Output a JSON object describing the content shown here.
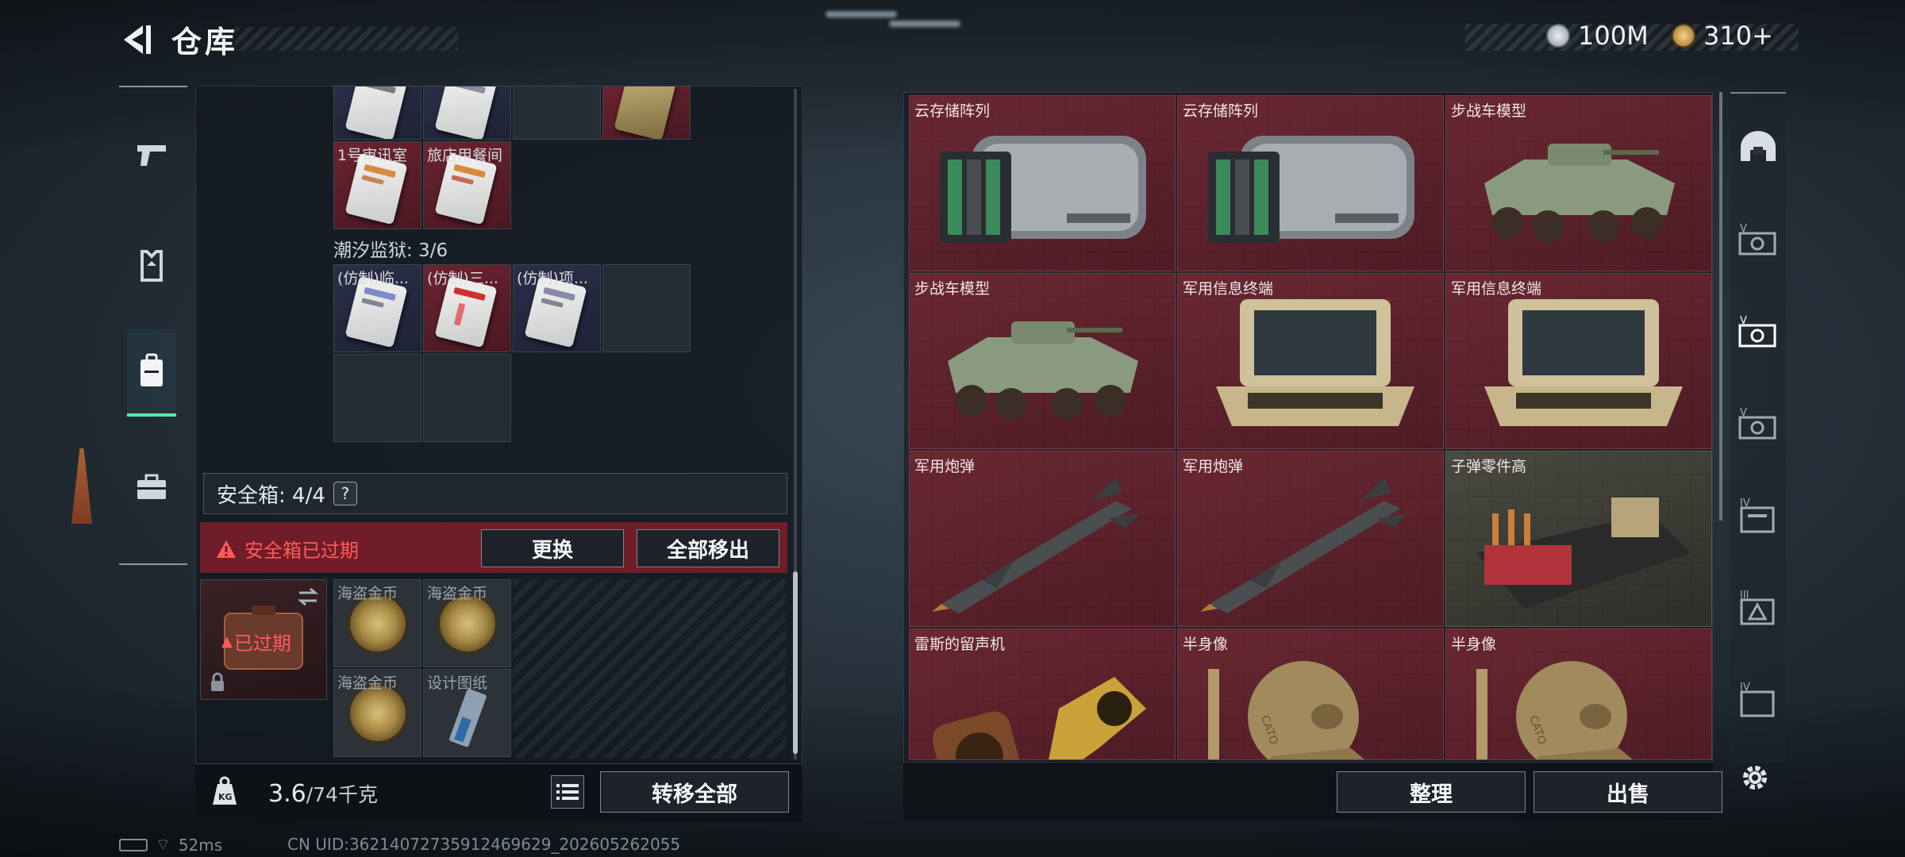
{
  "header": {
    "title": "仓库",
    "back_icon": "back-arrow-icon"
  },
  "currency": [
    {
      "icon": "silver-coin-icon",
      "value": "100M",
      "color": "#c9cfd6"
    },
    {
      "icon": "gold-coin-icon",
      "value": "310+",
      "color": "#d4a24c"
    }
  ],
  "left_nav": [
    {
      "icon": "pistol-icon",
      "active": false
    },
    {
      "icon": "armor-vest-icon",
      "active": false
    },
    {
      "icon": "backpack-icon",
      "active": true
    },
    {
      "icon": "briefcase-icon",
      "active": false
    }
  ],
  "stash": {
    "top_row_labels": [
      "",
      ""
    ],
    "row2_labels": [
      "1号审讯室",
      "旅店用餐间"
    ],
    "section_title": "潮汐监狱: 3/6",
    "section_items": [
      "(仿制)临...",
      "(仿制)三...",
      "(仿制)项..."
    ]
  },
  "safe_box": {
    "label": "安全箱: 4/4",
    "help": "?",
    "expired_warning": "安全箱已过期",
    "replace_button": "更换",
    "remove_all_button": "全部移出",
    "badge": "已过期",
    "items": [
      "海盗金币",
      "海盗金币",
      "海盗金币",
      "设计图纸"
    ]
  },
  "footer_left": {
    "kg_icon": "KG",
    "weight_current": "3.6",
    "weight_max": "/74千克",
    "transfer_all": "转移全部"
  },
  "right_grid": [
    {
      "label": "云存储阵列",
      "kind": "server"
    },
    {
      "label": "云存储阵列",
      "kind": "server"
    },
    {
      "label": "步战车模型",
      "kind": "vehicle"
    },
    {
      "label": "步战车模型",
      "kind": "vehicle"
    },
    {
      "label": "军用信息终端",
      "kind": "terminal"
    },
    {
      "label": "军用信息终端",
      "kind": "terminal"
    },
    {
      "label": "军用炮弹",
      "kind": "missile"
    },
    {
      "label": "军用炮弹",
      "kind": "missile"
    },
    {
      "label": "子弹零件高",
      "kind": "ammo"
    },
    {
      "label": "雷斯的留声机",
      "kind": "gramophone"
    },
    {
      "label": "半身像",
      "kind": "bust"
    },
    {
      "label": "半身像",
      "kind": "bust"
    }
  ],
  "right_nav": [
    {
      "icon": "helmet-icon",
      "tier": ""
    },
    {
      "icon": "vest-tier-icon",
      "tier": "V"
    },
    {
      "icon": "vest-tier-icon",
      "tier": "V"
    },
    {
      "icon": "vest-tier-icon",
      "tier": "V"
    },
    {
      "icon": "vest-tier-icon",
      "tier": "IV"
    },
    {
      "icon": "vest-tier-icon",
      "tier": "III"
    },
    {
      "icon": "vest-tier-icon",
      "tier": "IV"
    }
  ],
  "footer_right": {
    "sort": "整理",
    "sell": "出售"
  },
  "status": {
    "ping": "52ms",
    "uid": "CN UID:36214072735912469629_202605262055"
  },
  "colors": {
    "accent": "#5fe3b0",
    "expired": "#ff5a5a",
    "item_red": "#5a1f29"
  }
}
